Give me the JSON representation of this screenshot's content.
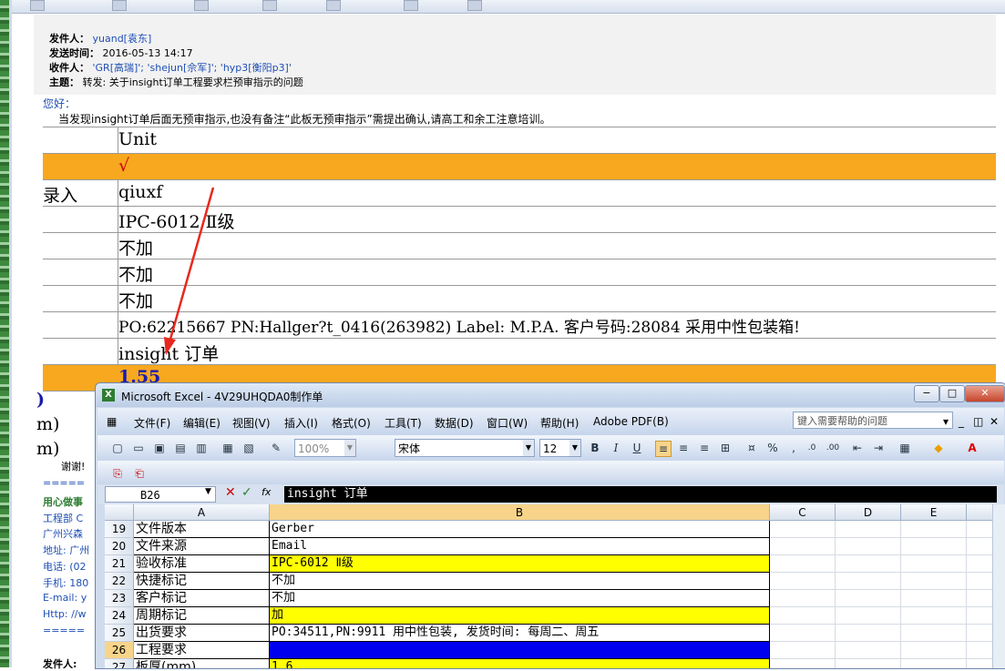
{
  "email": {
    "from_label": "发件人：",
    "from": "yuand[袁东]",
    "sent_label": "发送时间：",
    "sent": "2016-05-13 14:17",
    "to_label": "收件人：",
    "to": "'GR[高瑞]'; 'shejun[佘军]'; 'hyp3[衡阳p3]'",
    "subject_label": "主题：",
    "subject": "转发: 关于insight订单工程要求栏预审指示的问题",
    "greeting": "您好：",
    "message": "当发现insight订单后面无预审指示,也没有备注“此板无预审指示”需提出确认,请高工和余工注意培训。",
    "table_rows": [
      {
        "c1": "",
        "c2": "Unit"
      },
      {
        "c1": "",
        "c2": "√"
      },
      {
        "c1": "录入",
        "c2": "qiuxf"
      },
      {
        "c1": "",
        "c2": "IPC-6012 Ⅱ级"
      },
      {
        "c1": "",
        "c2": "不加"
      },
      {
        "c1": "",
        "c2": "不加"
      },
      {
        "c1": "",
        "c2": "不加"
      },
      {
        "c1": "",
        "c2": "PO:62215667 PN:Hallger?t_0416(263982) Label: M.P.A. 客户号码:28084 采用中性包装箱!"
      },
      {
        "c1": "",
        "c2": "insight 订单"
      },
      {
        "c1": "",
        "c2": "1.55"
      }
    ],
    "fragments": {
      "a": ")",
      "b": "m)",
      "c": "m)"
    },
    "thanks": "谢谢!",
    "sig_sep": "=====",
    "sig_motto": "用心做事",
    "sig_dept": "工程部  C",
    "sig_company": "广州兴森",
    "sig_address": "地址: 广州",
    "sig_phone": "电话: (02",
    "sig_mobile": "手机: 180",
    "sig_email": "E-mail: y",
    "sig_http": "Http: //w",
    "sig_sep2": "=====",
    "next_from": "发件人:"
  },
  "excel": {
    "title": "Microsoft Excel - 4V29UHQDA0制作单",
    "menus": [
      "文件(F)",
      "编辑(E)",
      "视图(V)",
      "插入(I)",
      "格式(O)",
      "工具(T)",
      "数据(D)",
      "窗口(W)",
      "帮助(H)",
      "Adobe PDF(B)"
    ],
    "ask_placeholder": "键入需要帮助的问题",
    "zoom": "100%",
    "font": "宋体",
    "size": "12",
    "namebox": "B26",
    "formula": "insight 订单",
    "columns": [
      "A",
      "B",
      "C",
      "D",
      "E"
    ],
    "rows": [
      {
        "n": "19",
        "a": "文件版本",
        "b": "Gerber",
        "hl": ""
      },
      {
        "n": "20",
        "a": "文件来源",
        "b": "Email",
        "hl": ""
      },
      {
        "n": "21",
        "a": "验收标准",
        "b": "IPC-6012 Ⅱ级",
        "hl": "yel"
      },
      {
        "n": "22",
        "a": "快捷标记",
        "b": "不加",
        "hl": ""
      },
      {
        "n": "23",
        "a": "客户标记",
        "b": "不加",
        "hl": ""
      },
      {
        "n": "24",
        "a": "周期标记",
        "b": "加",
        "hl": "yel"
      },
      {
        "n": "25",
        "a": "出货要求",
        "b": "PO:34511,PN:9911 用中性包装, 发货时间: 每周二、周五",
        "hl": ""
      },
      {
        "n": "26",
        "a": "工程要求",
        "b": "insight 订单",
        "hl": "sel"
      },
      {
        "n": "27",
        "a": "板厚(mm)",
        "b": "1.6",
        "hl": "yel"
      }
    ]
  },
  "colors": {
    "orange": "#f7a81e",
    "link": "#1f4fb4",
    "selection": "#0000ee",
    "annotation": "#e8281e"
  }
}
